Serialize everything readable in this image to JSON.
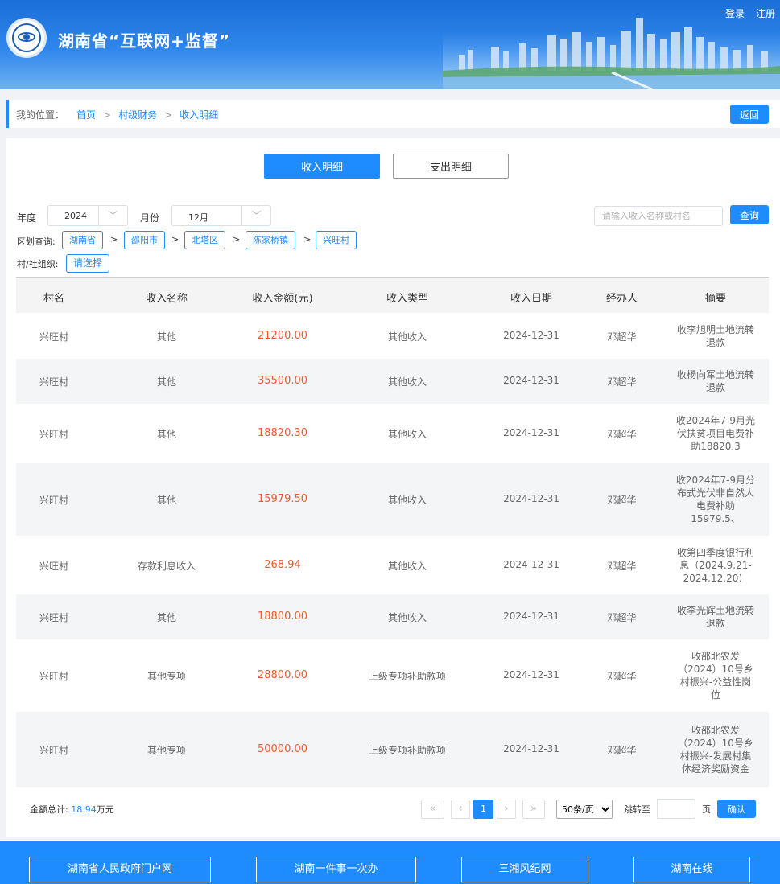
{
  "header": {
    "title": "湖南省“互联网+监督”",
    "links": [
      "登录",
      "注册"
    ]
  },
  "breadcrumb": {
    "label": "我的位置：",
    "items": [
      "首页",
      "村级财务",
      "收入明细"
    ],
    "sep": ">",
    "back": "返回"
  },
  "tabs": [
    "收入明细",
    "支出明细"
  ],
  "filters": {
    "year_label": "年度",
    "year_value": "2024",
    "month_label": "月份",
    "month_value": "12月",
    "search_placeholder": "请输入收入名称或村名",
    "query": "查询",
    "region_label": "区划查询:",
    "regions": [
      "湖南省",
      "邵阳市",
      "北塔区",
      "陈家桥镇",
      "兴旺村"
    ],
    "region_sep": ">",
    "org_label": "村/社组织:",
    "org_value": "请选择"
  },
  "table": {
    "headers": [
      "村名",
      "收入名称",
      "收入金额(元)",
      "收入类型",
      "收入日期",
      "经办人",
      "摘要"
    ],
    "rows": [
      {
        "village": "兴旺村",
        "name": "其他",
        "amount": "21200.00",
        "type": "其他收入",
        "date": "2024-12-31",
        "handler": "邓超华",
        "memo": [
          "收李旭明土地流转",
          "退款"
        ]
      },
      {
        "village": "兴旺村",
        "name": "其他",
        "amount": "35500.00",
        "type": "其他收入",
        "date": "2024-12-31",
        "handler": "邓超华",
        "memo": [
          "收杨向军土地流转",
          "退款"
        ]
      },
      {
        "village": "兴旺村",
        "name": "其他",
        "amount": "18820.30",
        "type": "其他收入",
        "date": "2024-12-31",
        "handler": "邓超华",
        "memo": [
          "收2024年7-9月光",
          "伏扶贫项目电费补",
          "助18820.3"
        ]
      },
      {
        "village": "兴旺村",
        "name": "其他",
        "amount": "15979.50",
        "type": "其他收入",
        "date": "2024-12-31",
        "handler": "邓超华",
        "memo": [
          "收2024年7-9月分",
          "布式光伏非自然人",
          "电费补助",
          "15979.5、"
        ]
      },
      {
        "village": "兴旺村",
        "name": "存款利息收入",
        "amount": "268.94",
        "type": "其他收入",
        "date": "2024-12-31",
        "handler": "邓超华",
        "memo": [
          "收第四季度银行利",
          "息（2024.9.21-",
          "2024.12.20）"
        ]
      },
      {
        "village": "兴旺村",
        "name": "其他",
        "amount": "18800.00",
        "type": "其他收入",
        "date": "2024-12-31",
        "handler": "邓超华",
        "memo": [
          "收李光辉土地流转",
          "退款"
        ]
      },
      {
        "village": "兴旺村",
        "name": "其他专项",
        "amount": "28800.00",
        "type": "上级专项补助款项",
        "date": "2024-12-31",
        "handler": "邓超华",
        "memo": [
          "收邵北农发",
          "（2024）10号乡",
          "村振兴-公益性岗",
          "位"
        ]
      },
      {
        "village": "兴旺村",
        "name": "其他专项",
        "amount": "50000.00",
        "type": "上级专项补助款项",
        "date": "2024-12-31",
        "handler": "邓超华",
        "memo": [
          "收邵北农发",
          "（2024）10号乡",
          "村振兴-发展村集",
          "体经济奖励资金"
        ]
      }
    ]
  },
  "summary": {
    "label": "金额总计:",
    "value": "18.94",
    "unit": "万元"
  },
  "pagination": {
    "first": "«",
    "prev": "‹",
    "current": "1",
    "next": "›",
    "last": "»",
    "per_page": "50条/页",
    "jump_label": "跳转至",
    "page_unit": "页",
    "confirm": "确认"
  },
  "footer": {
    "links": [
      "湖南省人民政府门户网",
      "湖南一件事一次办",
      "三湘风纪网",
      "湖南在线"
    ]
  },
  "colors": {
    "accent": "#1e8bff",
    "amount": "#ee5a2f",
    "header_top": "#1a6fd8"
  }
}
